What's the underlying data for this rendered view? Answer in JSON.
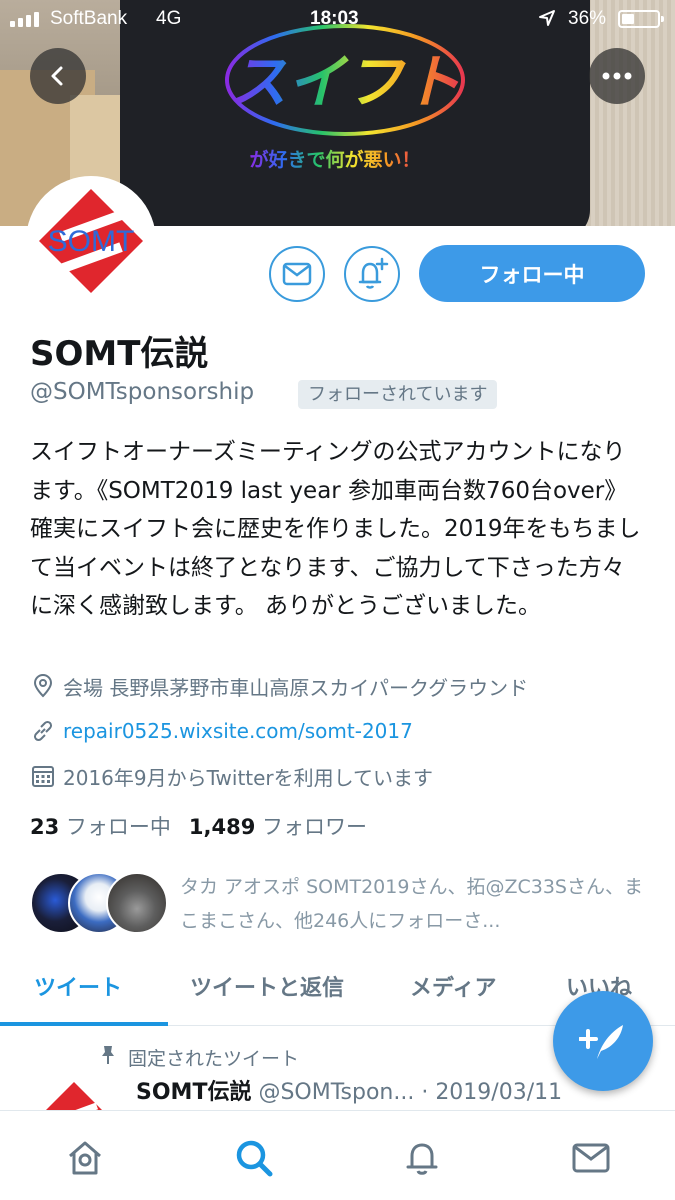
{
  "status_bar": {
    "carrier": "SoftBank",
    "network": "4G",
    "time": "18:03",
    "battery": "36%"
  },
  "banner": {
    "logo_text": "スイフト",
    "tagline": "が好きで何が悪い！"
  },
  "profile": {
    "avatar_text": "SOMT",
    "display_name": "SOMT伝説",
    "handle": "@SOMTsponsorship",
    "follows_you": "フォローされています",
    "follow_button": "フォロー中",
    "bio": "スイフトオーナーズミーティングの公式アカウントになります。《SOMT2019 last year 参加車両台数760台over》 確実にスイフト会に歴史を作りました。2019年をもちまして当イベントは終了となります、ご協力して下さった方々に深く感謝致します。 ありがとうございました。",
    "location": "会場 長野県茅野市車山高原スカイパークグラウンド",
    "url": "repair0525.wixsite.com/somt-2017",
    "joined": "2016年9月からTwitterを利用しています",
    "following_count": "23",
    "following_label": "フォロー中",
    "followers_count": "1,489",
    "followers_label": "フォロワー",
    "followers_you_know": "タカ アオスポ SOMT2019さん、拓@ZC33Sさん、まこまこさん、他246人にフォローさ..."
  },
  "tabs": [
    {
      "label": "ツイート",
      "active": true
    },
    {
      "label": "ツイートと返信",
      "active": false
    },
    {
      "label": "メディア",
      "active": false
    },
    {
      "label": "いいね",
      "active": false
    }
  ],
  "pinned_tweet": {
    "label": "固定されたツイート",
    "name": "SOMT伝説",
    "handle": "@SOMTspon...",
    "date": "· 2019/03/11"
  },
  "icons": {
    "back": "chevron-left-icon",
    "more": "more-horizontal-icon",
    "message": "mail-icon",
    "notify": "bell-plus-icon",
    "location": "location-pin-icon",
    "link": "link-icon",
    "calendar": "calendar-icon",
    "pin": "pin-icon",
    "compose": "compose-tweet-icon",
    "home": "home-icon",
    "search": "search-icon",
    "notifications": "bell-icon",
    "messages": "mail-icon"
  },
  "colors": {
    "accent": "#1b95e0",
    "follow_button": "#3d9ae8",
    "secondary_text": "#657786",
    "avatar_red": "#e0262d"
  }
}
